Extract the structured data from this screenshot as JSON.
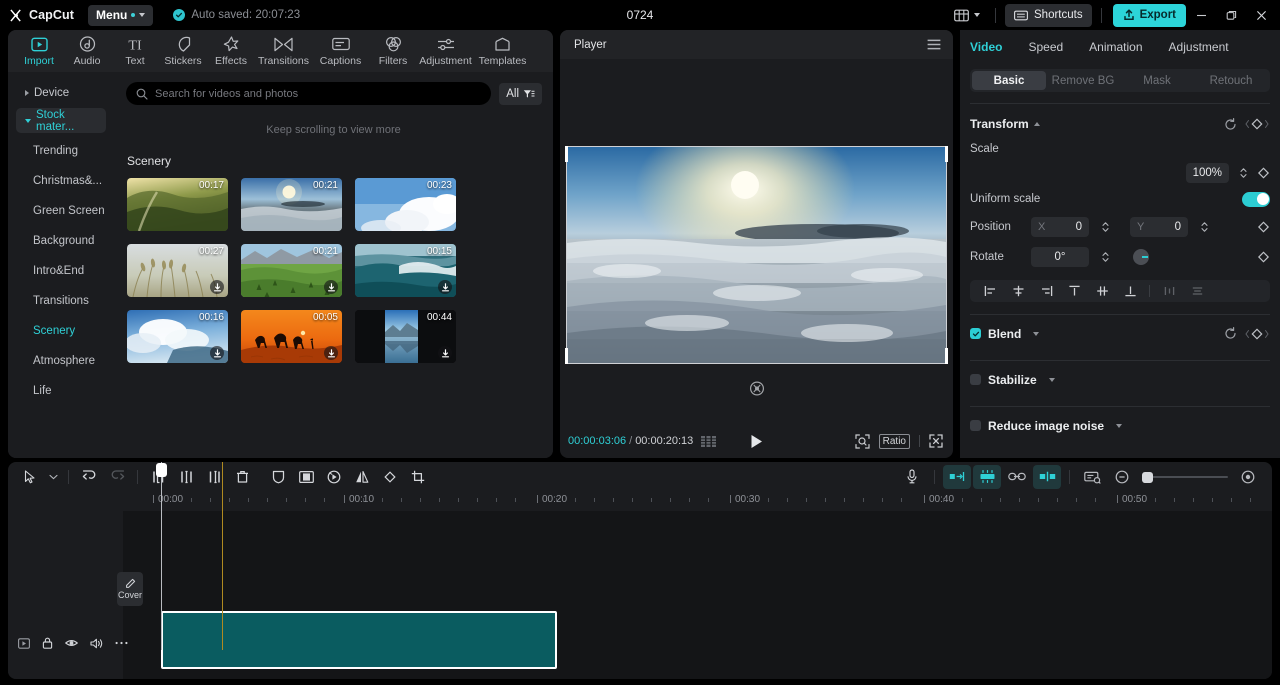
{
  "titlebar": {
    "brand": "CapCut",
    "menu_label": "Menu",
    "autosave_text": "Auto saved: 20:07:23",
    "project_title": "0724",
    "shortcuts_label": "Shortcuts",
    "export_label": "Export",
    "icons": {
      "layout": "layout-icon",
      "minimize": "minimize-icon",
      "maximize": "maximize-icon",
      "close": "close-icon"
    }
  },
  "media_tabs": [
    {
      "label": "Import",
      "icon": "import-icon",
      "active": true
    },
    {
      "label": "Audio",
      "icon": "audio-icon",
      "active": false
    },
    {
      "label": "Text",
      "icon": "text-icon",
      "active": false
    },
    {
      "label": "Stickers",
      "icon": "stickers-icon",
      "active": false
    },
    {
      "label": "Effects",
      "icon": "effects-icon",
      "active": false
    },
    {
      "label": "Transitions",
      "icon": "transitions-icon",
      "active": false
    },
    {
      "label": "Captions",
      "icon": "captions-icon",
      "active": false
    },
    {
      "label": "Filters",
      "icon": "filters-icon",
      "active": false
    },
    {
      "label": "Adjustment",
      "icon": "adjustment-icon",
      "active": false
    },
    {
      "label": "Templates",
      "icon": "templates-icon",
      "active": false
    }
  ],
  "sidebar": {
    "device_label": "Device",
    "stock_label": "Stock mater...",
    "categories": [
      {
        "label": "Trending",
        "active": false
      },
      {
        "label": "Christmas&...",
        "active": false
      },
      {
        "label": "Green Screen",
        "active": false
      },
      {
        "label": "Background",
        "active": false
      },
      {
        "label": "Intro&End",
        "active": false
      },
      {
        "label": "Transitions",
        "active": false
      },
      {
        "label": "Scenery",
        "active": true
      },
      {
        "label": "Atmosphere",
        "active": false
      },
      {
        "label": "Life",
        "active": false
      }
    ]
  },
  "browser": {
    "search_placeholder": "Search for videos and photos",
    "filter_label": "All",
    "scroll_hint": "Keep scrolling to view more",
    "section_title": "Scenery",
    "items": [
      {
        "duration": "00:17",
        "art": "forest-sunrise",
        "download": false
      },
      {
        "duration": "00:21",
        "art": "sun-clouds",
        "download": false
      },
      {
        "duration": "00:23",
        "art": "cumulus-sky",
        "download": false
      },
      {
        "duration": "00:27",
        "art": "grass-field",
        "download": true
      },
      {
        "duration": "00:21",
        "art": "green-hills",
        "download": true
      },
      {
        "duration": "00:15",
        "art": "ocean-wave",
        "download": true
      },
      {
        "duration": "00:16",
        "art": "cloud-peak",
        "download": true
      },
      {
        "duration": "00:05",
        "art": "camel-sunset",
        "download": true
      },
      {
        "duration": "00:44",
        "art": "lake-portrait",
        "download": true
      }
    ]
  },
  "player": {
    "title": "Player",
    "menu_icon": "hamburger-icon",
    "current_time": "00:00:03:06",
    "separator": "/",
    "total_time": "00:00:20:13",
    "ratio_label": "Ratio",
    "icons": {
      "frames": "frames-icon",
      "play": "play-icon",
      "zoom_fit": "zoom-fit-icon",
      "fullscreen": "fullscreen-icon",
      "watermark": "watermark-icon"
    }
  },
  "properties": {
    "tabs": [
      {
        "label": "Video",
        "active": true
      },
      {
        "label": "Speed",
        "active": false
      },
      {
        "label": "Animation",
        "active": false
      },
      {
        "label": "Adjustment",
        "active": false
      }
    ],
    "segments": [
      {
        "label": "Basic",
        "active": true
      },
      {
        "label": "Remove BG",
        "active": false
      },
      {
        "label": "Mask",
        "active": false
      },
      {
        "label": "Retouch",
        "active": false
      }
    ],
    "transform": {
      "title": "Transform",
      "scale_label": "Scale",
      "scale_value": "100%",
      "uniform_label": "Uniform scale",
      "uniform_on": true,
      "position_label": "Position",
      "position_x_axis": "X",
      "position_x": "0",
      "position_y_axis": "Y",
      "position_y": "0",
      "rotate_label": "Rotate",
      "rotate_value": "0°"
    },
    "sections": [
      {
        "label": "Blend",
        "checked": true
      },
      {
        "label": "Stabilize",
        "checked": false
      },
      {
        "label": "Reduce image noise",
        "checked": false
      }
    ]
  },
  "timeline": {
    "toolbar_left": [
      "select-cursor-icon",
      "chevron-down-icon",
      "undo-icon",
      "redo-icon",
      "split-left-icon",
      "split-icon",
      "split-right-icon",
      "delete-icon",
      "mask-icon",
      "freeze-frame-icon",
      "speed-icon",
      "mirror-icon",
      "rotate-icon",
      "crop-icon"
    ],
    "toolbar_right": [
      "microphone-icon",
      "snap-left-icon",
      "auto-snap-icon",
      "link-icon",
      "snap-center-icon",
      "preview-icon",
      "zoom-out-icon",
      "zoom-in-icon"
    ],
    "ruler_labels": [
      "00:00",
      "00:10",
      "00:20",
      "00:30",
      "00:40",
      "00:50"
    ],
    "track_controls": [
      "video-track-icon",
      "lock-icon",
      "eye-icon",
      "speaker-icon",
      "more-icon"
    ],
    "cover_label": "Cover",
    "cover_icon": "pencil-icon",
    "clip_color": "#0a5c60"
  },
  "colors": {
    "accent": "#2fd0d6",
    "export": "#2cd4d9",
    "panel": "#1b1c1f",
    "tabbar": "#222326",
    "timeline_bg": "#141517",
    "clip": "#0a5c60",
    "playhead": "#b9bcc1",
    "amber": "#b08a20"
  }
}
